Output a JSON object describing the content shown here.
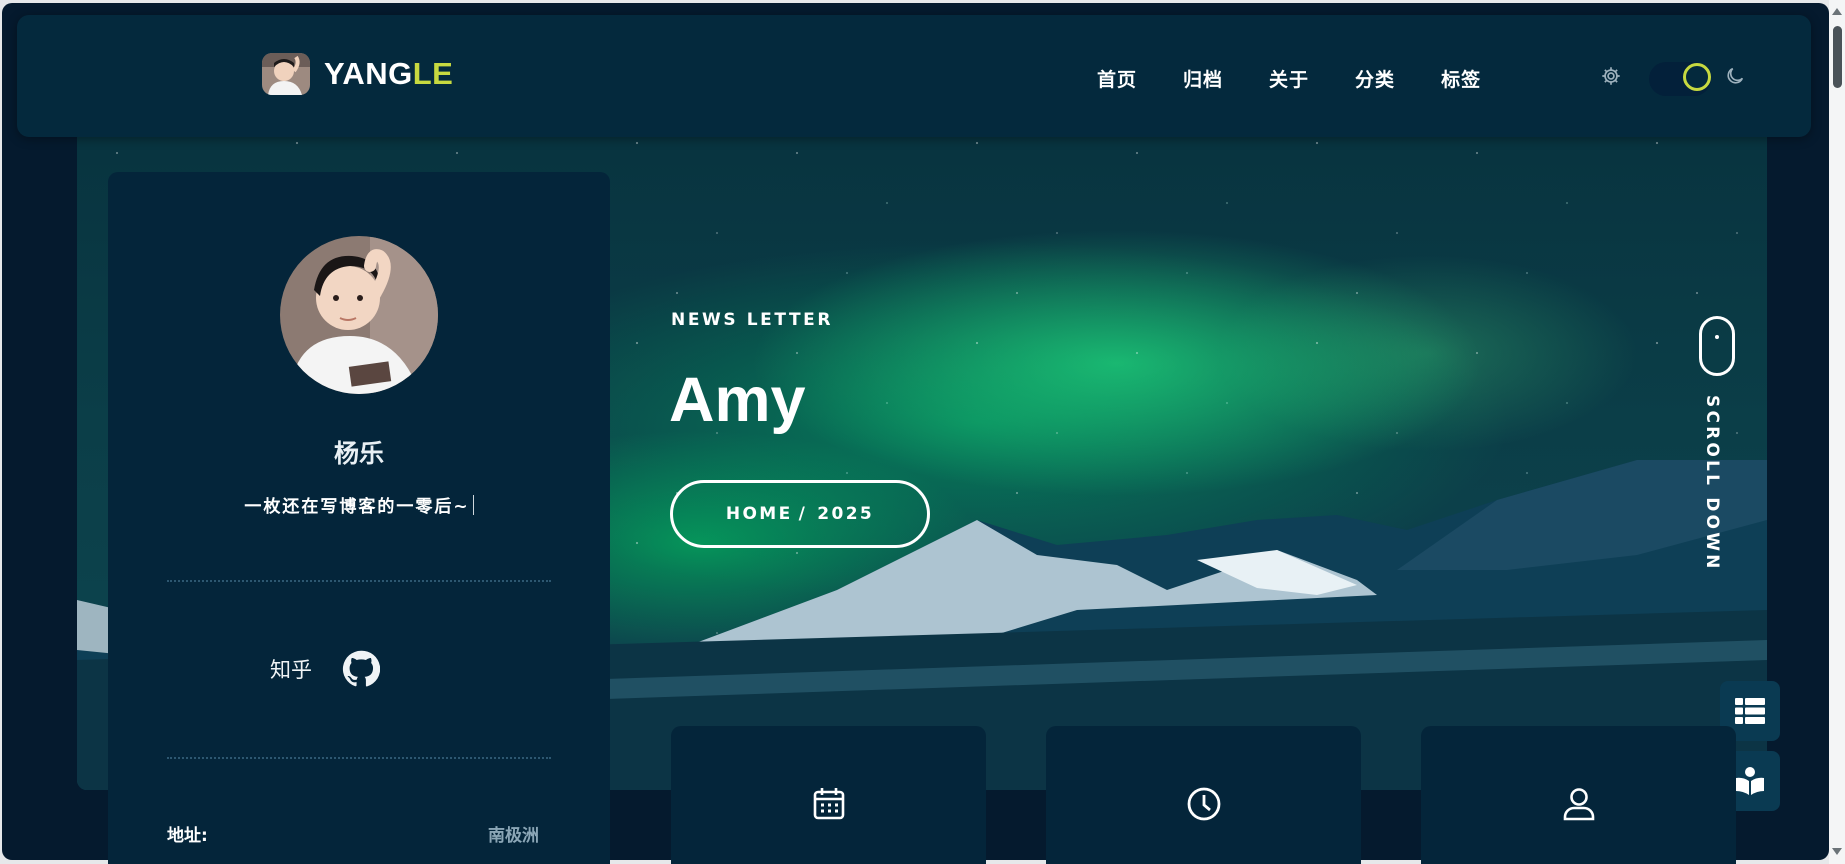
{
  "header": {
    "logo_main": "YANG",
    "logo_accent": "LE",
    "nav": [
      "首页",
      "归档",
      "关于",
      "分类",
      "标签"
    ],
    "theme_icons": [
      "gear-icon",
      "toggle-switch",
      "moon-icon"
    ],
    "accent_color": "#c7d940"
  },
  "profile": {
    "name": "杨乐",
    "motto": "一枚还在写博客的一零后~",
    "social_text": "知乎",
    "social_icon": "github-icon",
    "address_label": "地址:",
    "address_value": "南极洲"
  },
  "hero": {
    "eyebrow": "NEWS LETTER",
    "title": "Amy",
    "crumb_home": "HOME",
    "crumb_sep": "/",
    "crumb_year": "2025",
    "scroll_text": "SCROLL DOWN"
  },
  "side_buttons": [
    "list-icon",
    "book-reader-icon"
  ],
  "stat_cards": [
    "calendar-icon",
    "clock-icon",
    "user-icon"
  ]
}
